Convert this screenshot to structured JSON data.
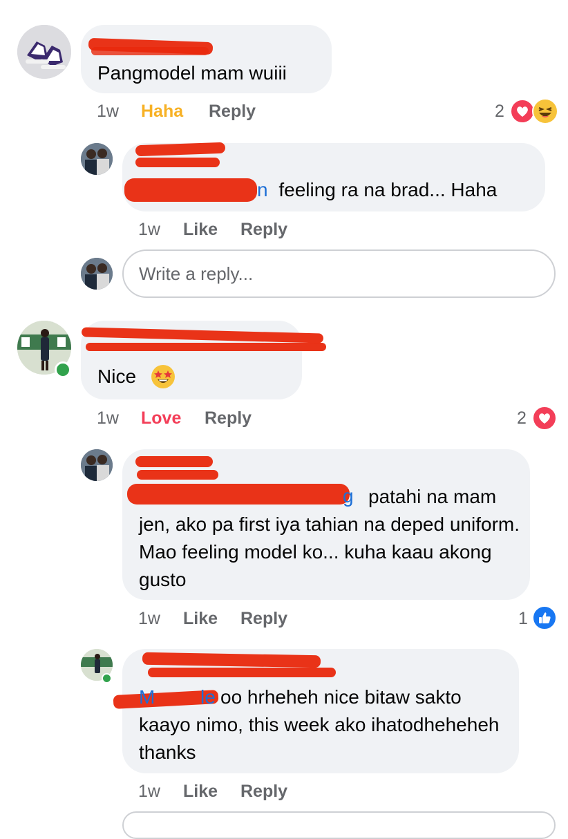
{
  "comments": [
    {
      "text": "Pangmodel mam wuiii",
      "time": "1w",
      "reaction_action": "Haha",
      "reply_label": "Reply",
      "reaction_count": "2",
      "reaction_icons": [
        "heart-icon",
        "laughing-face-icon"
      ]
    },
    {
      "text": "Nice",
      "emoji": "star-struck-emoji-icon",
      "time": "1w",
      "reaction_action": "Love",
      "reply_label": "Reply",
      "reaction_count": "2",
      "reaction_icons": [
        "heart-icon"
      ]
    }
  ],
  "replies": [
    {
      "mention_visible": "n",
      "text": "feeling ra na brad... Haha",
      "time": "1w",
      "like_label": "Like",
      "reply_label": "Reply"
    },
    {
      "mention_visible": "g",
      "text": "patahi na mam jen, ako pa first iya tahian na deped uniform. Mao feeling model ko... kuha kaau akong gusto",
      "time": "1w",
      "like_label": "Like",
      "reply_label": "Reply",
      "reaction_count": "1",
      "reaction_icons": [
        "thumbs-up-icon"
      ]
    },
    {
      "mention_visible": "M",
      "mention_visible_end": "le",
      "text": "oo hrheheh nice bitaw sakto kaayo nimo,  this week ako ihatodheheheh thanks",
      "time": "1w",
      "like_label": "Like",
      "reply_label": "Reply"
    }
  ],
  "reply_input": {
    "placeholder": "Write a reply..."
  },
  "colors": {
    "bubble": "#f0f2f5",
    "redaction": "#e8280c",
    "haha": "#f7b125",
    "love": "#f33e58",
    "like_blue": "#1877f2",
    "meta_gray": "#65676b"
  }
}
